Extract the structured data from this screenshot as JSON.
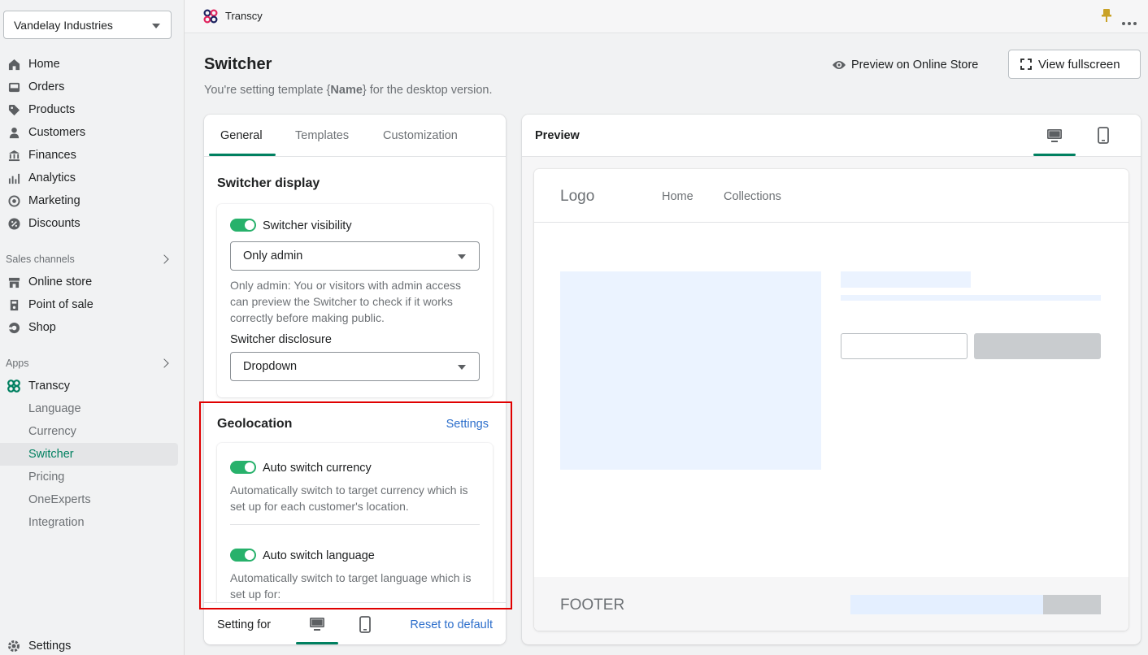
{
  "store": {
    "name": "Vandelay Industries"
  },
  "sidebar": {
    "main": [
      {
        "label": "Home",
        "icon": "home-icon"
      },
      {
        "label": "Orders",
        "icon": "orders-icon"
      },
      {
        "label": "Products",
        "icon": "tag-icon"
      },
      {
        "label": "Customers",
        "icon": "person-icon"
      },
      {
        "label": "Finances",
        "icon": "bank-icon"
      },
      {
        "label": "Analytics",
        "icon": "bar-chart-icon"
      },
      {
        "label": "Marketing",
        "icon": "target-icon"
      },
      {
        "label": "Discounts",
        "icon": "discount-icon"
      }
    ],
    "sales_channels_label": "Sales channels",
    "sales_channels": [
      {
        "label": "Online store",
        "icon": "store-icon"
      },
      {
        "label": "Point of sale",
        "icon": "pos-icon"
      },
      {
        "label": "Shop",
        "icon": "shop-icon"
      }
    ],
    "apps_label": "Apps",
    "app": {
      "label": "Transcy",
      "icon": "transcy-icon"
    },
    "app_items": [
      {
        "label": "Language"
      },
      {
        "label": "Currency"
      },
      {
        "label": "Switcher",
        "active": true
      },
      {
        "label": "Pricing"
      },
      {
        "label": "OneExperts"
      },
      {
        "label": "Integration"
      }
    ],
    "settings_label": "Settings"
  },
  "topbar": {
    "app_title": "Transcy"
  },
  "page": {
    "title": "Switcher",
    "subtitle_before": "You're setting template {",
    "subtitle_bold": "Name",
    "subtitle_after": "} for the desktop version.",
    "preview_link": "Preview on Online Store",
    "fullscreen_button": "View fullscreen"
  },
  "left": {
    "tabs": [
      "General",
      "Templates",
      "Customization"
    ],
    "switcher_display": {
      "title": "Switcher display",
      "visibility_label": "Switcher visibility",
      "visibility_on": true,
      "visibility_value": "Only admin",
      "visibility_help": "Only admin: You or visitors with admin access can preview the Switcher to check if it works correctly before making public.",
      "disclosure_label": "Switcher disclosure",
      "disclosure_value": "Dropdown"
    },
    "geolocation": {
      "title": "Geolocation",
      "settings_link": "Settings",
      "currency_label": "Auto switch currency",
      "currency_on": true,
      "currency_help": "Automatically switch to target currency which is set up for each customer's location.",
      "language_label": "Auto switch language",
      "language_on": true,
      "language_help": "Automatically switch to target language which is set up for:"
    },
    "bottom": {
      "setting_for": "Setting for",
      "reset": "Reset to default"
    }
  },
  "preview": {
    "title": "Preview",
    "mock": {
      "logo": "Logo",
      "nav": [
        "Home",
        "Collections"
      ],
      "footer": "FOOTER"
    }
  },
  "colors": {
    "accent": "#008060",
    "toggle_on": "#27b16b",
    "link": "#2c6ecb",
    "highlight": "#e00000"
  }
}
